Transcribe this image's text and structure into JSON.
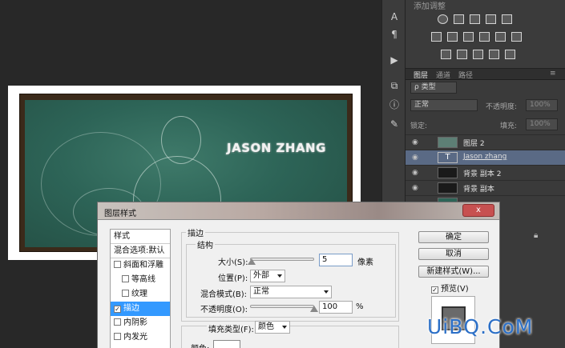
{
  "artwork": {
    "title": "JASON ZHANG"
  },
  "tool_strip": {
    "icons": [
      "character-icon",
      "paragraph-icon",
      "play-icon",
      "layers-comp-icon",
      "info-icon",
      "brush-tool-icon"
    ]
  },
  "adjustments": {
    "title": "添加调整"
  },
  "layers_panel": {
    "tabs": [
      "图层",
      "通道",
      "路径"
    ],
    "filter_kind": "ρ 类型",
    "blend_mode": "正常",
    "opacity_label": "不透明度:",
    "opacity_value": "100%",
    "lock_label": "锁定:",
    "fill_label": "填充:",
    "fill_value": "100%",
    "layers": [
      {
        "name": "图层 2",
        "selected": false
      },
      {
        "name": "Jason zhang",
        "selected": true
      },
      {
        "name": "背景 副本 2",
        "selected": false
      },
      {
        "name": "背景 副本",
        "selected": false
      }
    ]
  },
  "dialog": {
    "title": "图层样式",
    "close_label": "x",
    "style_list": {
      "header": "样式",
      "items": [
        {
          "label": "混合选项:默认",
          "checkbox": false,
          "checked": false,
          "selected": false
        },
        {
          "label": "斜面和浮雕",
          "checkbox": true,
          "checked": false,
          "selected": false
        },
        {
          "label": "等高线",
          "checkbox": true,
          "checked": false,
          "selected": false
        },
        {
          "label": "纹理",
          "checkbox": true,
          "checked": false,
          "selected": false
        },
        {
          "label": "描边",
          "checkbox": true,
          "checked": true,
          "selected": true
        },
        {
          "label": "内阴影",
          "checkbox": true,
          "checked": false,
          "selected": false
        },
        {
          "label": "内发光",
          "checkbox": true,
          "checked": false,
          "selected": false
        }
      ]
    },
    "section_title": "描边",
    "structure_title": "结构",
    "size_label": "大小(S):",
    "size_value": "5",
    "size_unit": "像素",
    "size_fraction": 0.02,
    "position_label": "位置(P):",
    "position_value": "外部",
    "blend_label": "混合模式(B):",
    "blend_value": "正常",
    "opacity_label": "不透明度(O):",
    "opacity_value": "100",
    "opacity_unit": "%",
    "opacity_fraction": 1.0,
    "fill_type_label": "填充类型(F):",
    "fill_type_value": "颜色",
    "color_label": "颜色:",
    "buttons": {
      "ok": "确定",
      "cancel": "取消",
      "new_style": "新建样式(W)..."
    },
    "preview_label": "预览(V)",
    "preview_checked": true
  },
  "watermark": "UiBQ.CoM"
}
